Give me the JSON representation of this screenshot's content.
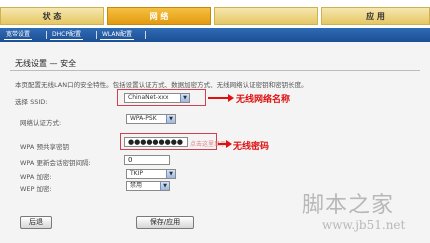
{
  "topnav": {
    "tabs": [
      {
        "label": "状 态",
        "active": false
      },
      {
        "label": "网 络",
        "active": true
      },
      {
        "label": "",
        "active": false
      },
      {
        "label": "应 用",
        "active": false
      }
    ]
  },
  "subnav": {
    "items": [
      "宽带设置",
      "DHCP配置",
      "WLAN配置"
    ]
  },
  "page": {
    "title": "无线设置 — 安全",
    "description": "本页配置无线LAN口的安全特性。包括设置认证方式、数据加密方式、无线网络认证密钥和密钥长度。",
    "ssid_label": "选择 SSID:",
    "ssid_value": "ChinaNet-xxx",
    "auth_label": "网络认证方式:",
    "auth_value": "WPA-PSK",
    "psk_label": "WPA 预共享密钥",
    "psk_value": "●●●●●●●●●",
    "psk_hint": "点击这里显示",
    "rekey_label": "WPA 更新会话密钥间隔:",
    "rekey_value": "0",
    "encrypt_label": "WPA 加密:",
    "encrypt_value": "TKIP",
    "wep_label": "WEP 加密:",
    "wep_value": "禁用"
  },
  "annotations": {
    "ssid_note": "无线网络名称",
    "psk_note": "无线密码",
    "color": "#e01010"
  },
  "buttons": {
    "back": "后退",
    "save": "保存/应用"
  },
  "watermark": {
    "site_cn": "脚本之家",
    "site_url": "www.jb51.net"
  }
}
